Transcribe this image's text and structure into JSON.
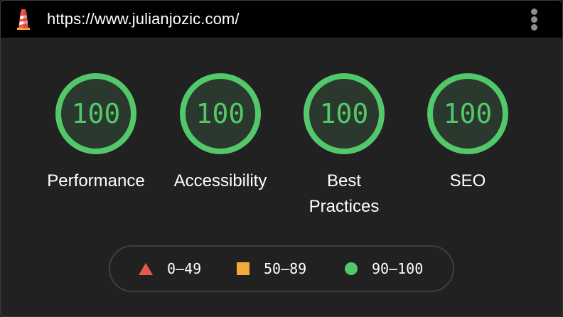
{
  "browser": {
    "url": "https://www.julianjozic.com/",
    "logo_icon": "lighthouse-icon",
    "menu_icon": "kebab-menu-icon"
  },
  "scores": [
    {
      "category": "Performance",
      "score": "100"
    },
    {
      "category": "Accessibility",
      "score": "100"
    },
    {
      "category": "Best Practices",
      "score": "100"
    },
    {
      "category": "SEO",
      "score": "100"
    }
  ],
  "legend": {
    "fail": {
      "range": "0–49",
      "shape": "triangle",
      "color": "#e8584d"
    },
    "average": {
      "range": "50–89",
      "shape": "square",
      "color": "#f4a93c"
    },
    "pass": {
      "range": "90–100",
      "shape": "circle",
      "color": "#53c86b"
    }
  },
  "colors": {
    "pass_green": "#53c86b",
    "background": "#212121",
    "header": "#000000"
  }
}
